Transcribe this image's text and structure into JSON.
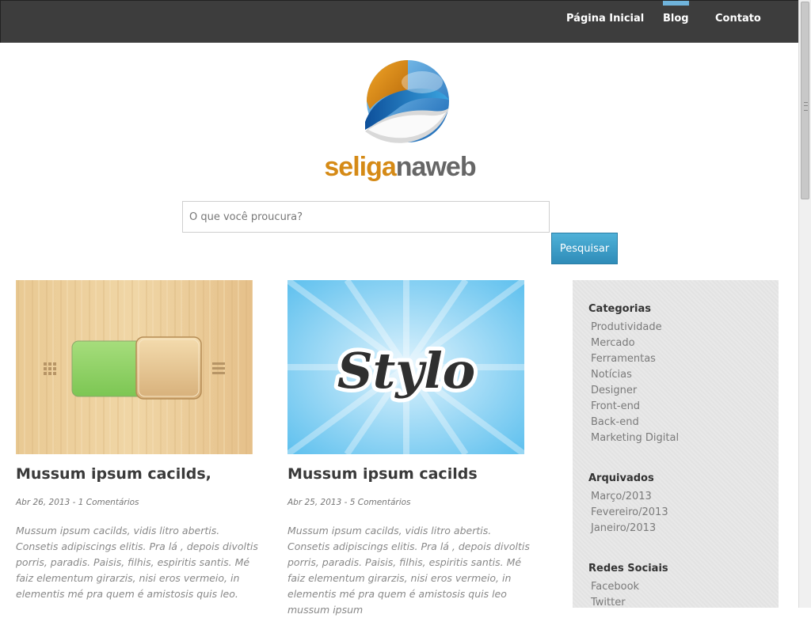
{
  "nav": {
    "items": [
      {
        "label": "Página Inicial",
        "active": false
      },
      {
        "label": "Blog",
        "active": true
      },
      {
        "label": "Contato",
        "active": false
      }
    ]
  },
  "logo": {
    "part1": "seliga",
    "part2": "na",
    "part3": "web"
  },
  "search": {
    "placeholder": "O que você proucura?",
    "value": "",
    "button_label": "Pesquisar"
  },
  "posts": [
    {
      "image": "wood-toggle-switch-image",
      "title": "Mussum ipsum cacilds,",
      "meta": "Abr 26, 2013 - 1 Comentários",
      "excerpt": "Mussum ipsum cacilds, vidis litro abertis. Consetis adipiscings elitis. Pra lá , depois divoltis porris, paradis. Paisis, filhis, espiritis santis. Mé faiz elementum girarzis, nisi eros vermeio, in elementis mé pra quem é amistosis quis leo."
    },
    {
      "image": "stylo-logo-image",
      "title": "Mussum ipsum cacilds",
      "meta": "Abr 25, 2013 - 5 Comentários",
      "excerpt": "Mussum ipsum cacilds, vidis litro abertis. Consetis adipiscings elitis. Pra lá , depois divoltis porris, paradis. Paisis, filhis, espiritis santis. Mé faiz elementum girarzis, nisi eros vermeio, in elementis mé pra quem é amistosis quis leo mussum ipsum"
    }
  ],
  "post_image_text": {
    "stylo": "Stylo"
  },
  "sidebar": {
    "categories": {
      "title": "Categorias",
      "items": [
        "Produtividade",
        "Mercado",
        "Ferramentas",
        "Notícias",
        "Designer",
        "Front-end",
        "Back-end",
        "Marketing Digital"
      ]
    },
    "archives": {
      "title": "Arquivados",
      "items": [
        "Março/2013",
        "Fevereiro/2013",
        "Janeiro/2013"
      ]
    },
    "social": {
      "title": "Redes Sociais",
      "items": [
        "Facebook",
        "Twitter"
      ]
    }
  },
  "colors": {
    "topbar": "#3d3d3d",
    "accent": "#6fb3db",
    "button": "#3a9bc7",
    "sidebar": "#e8e8e8"
  }
}
